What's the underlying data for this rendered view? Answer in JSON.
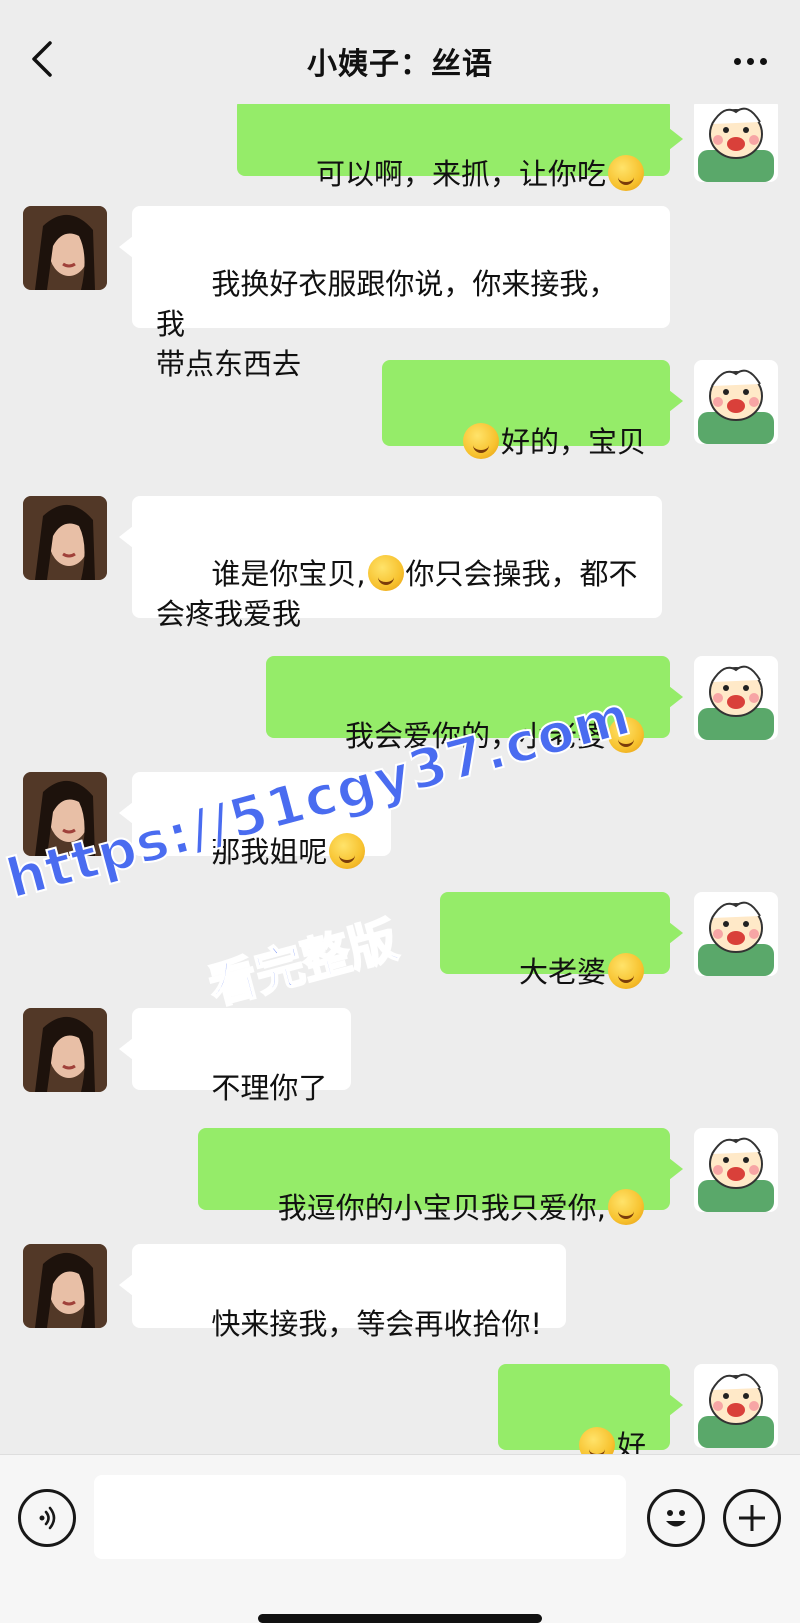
{
  "header": {
    "title": "小姨子：丝语",
    "back_icon": "chevron-left-icon",
    "more_icon": "more-horizontal-icon"
  },
  "messages": [
    {
      "side": "out",
      "text": "可以啊，来抓，让你吃",
      "emoji": "hand-over-mouth-emoji"
    },
    {
      "side": "in",
      "text": "我换好衣服跟你说，你来接我，我\n带点东西去"
    },
    {
      "side": "out",
      "prefix_emoji": "grinning-sweat-emoji",
      "text": "好的，宝贝"
    },
    {
      "side": "in",
      "text_a": "谁是你宝贝,",
      "emoji": "unamused-emoji",
      "text_b": "你只会操我，都不\n会疼我爱我"
    },
    {
      "side": "out",
      "text": "我会爱你的，小老婆",
      "emoji": "grinning-squint-emoji"
    },
    {
      "side": "in",
      "text": "那我姐呢",
      "emoji": "worried-emoji"
    },
    {
      "side": "out",
      "text": "大老婆",
      "emoji": "grin-emoji"
    },
    {
      "side": "in",
      "text": "不理你了"
    },
    {
      "side": "out",
      "text": "我逗你的小宝贝我只爱你,",
      "emoji": "kissing-emoji"
    },
    {
      "side": "in",
      "text": "快来接我，等会再收拾你!"
    },
    {
      "side": "out",
      "prefix_emoji": "ok-hand-emoji",
      "text": "好"
    }
  ],
  "watermark": {
    "line1": "https://51cgy37.com",
    "line2": "看完整版"
  },
  "input_bar": {
    "voice_icon": "voice-icon",
    "emoji_icon": "smiley-icon",
    "plus_icon": "plus-icon",
    "input_value": ""
  },
  "colors": {
    "background": "#ededed",
    "outgoing_bubble": "#95ec69",
    "incoming_bubble": "#ffffff",
    "watermark": "#4a6cf0"
  }
}
